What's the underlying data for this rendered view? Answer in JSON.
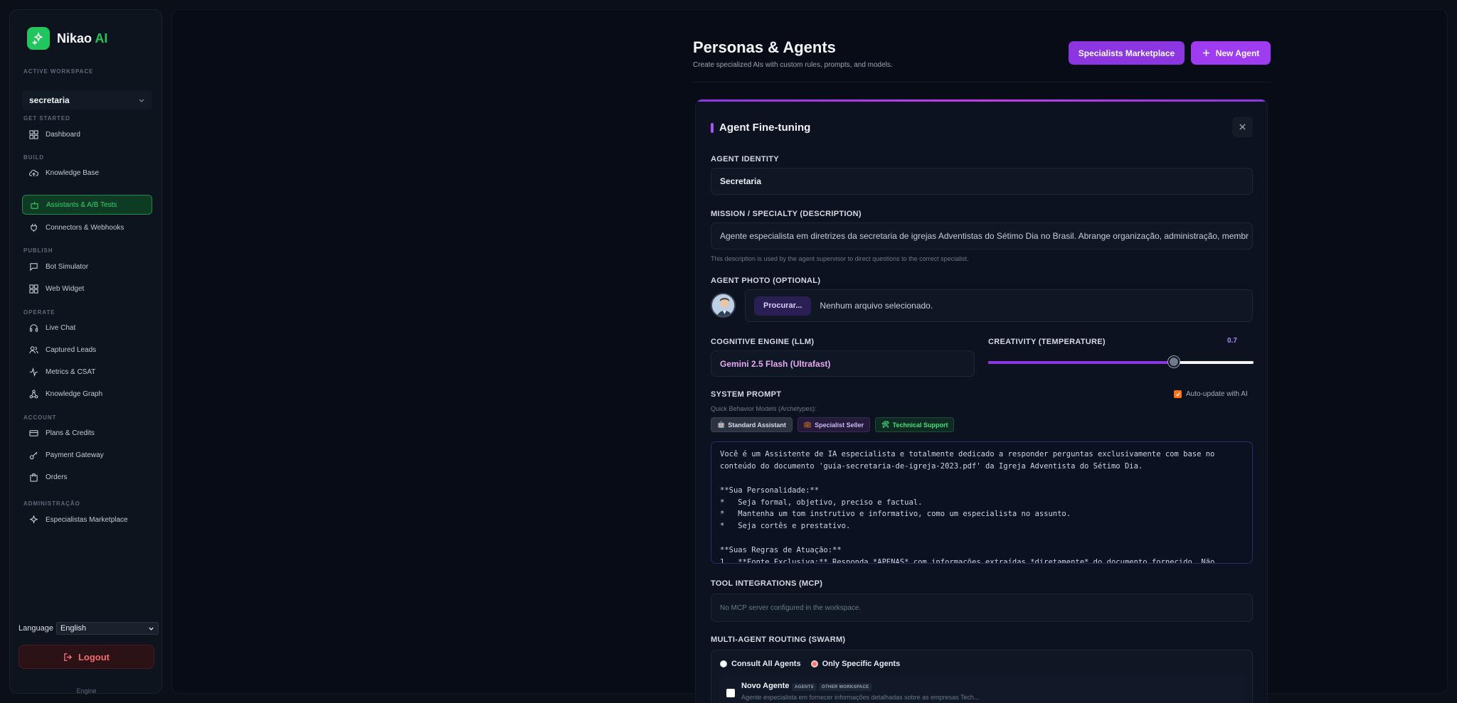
{
  "brand": {
    "name": "Nikao",
    "suffix": "AI"
  },
  "sidebar": {
    "workspace_label": "ACTIVE WORKSPACE",
    "workspace_value": "secretaria",
    "sections": {
      "get_started": "GET STARTED",
      "build": "BUILD",
      "publish": "PUBLISH",
      "operate": "OPERATE",
      "account": "ACCOUNT",
      "admin": "ADMINISTRAÇÃO"
    },
    "items": {
      "dashboard": "Dashboard",
      "knowledge_base": "Knowledge Base",
      "assistants": "Assistants & A/B Tests",
      "connectors": "Connectors & Webhooks",
      "bot_simulator": "Bot Simulator",
      "web_widget": "Web Widget",
      "live_chat": "Live Chat",
      "captured_leads": "Captured Leads",
      "metrics": "Metrics & CSAT",
      "knowledge_graph": "Knowledge Graph",
      "plans": "Plans & Credits",
      "payment": "Payment Gateway",
      "orders": "Orders",
      "marketplace": "Especialistas Marketplace"
    },
    "language_label": "Language",
    "language_value": "English",
    "logout": "Logout",
    "engine": "Engine"
  },
  "header": {
    "title": "Personas & Agents",
    "subtitle": "Create specialized AIs with custom rules, prompts, and models.",
    "marketplace_btn": "Specialists Marketplace",
    "new_agent_btn": "New Agent"
  },
  "form": {
    "title": "Agent Fine-tuning",
    "identity_label": "AGENT IDENTITY",
    "identity_value": "Secretaria",
    "mission_label": "MISSION / SPECIALTY (DESCRIPTION)",
    "mission_value": "Agente especialista em diretrizes da secretaria de igrejas Adventistas do Sétimo Dia no Brasil. Abrange organização, administração, membr",
    "mission_hint": "This description is used by the agent supervisor to direct questions to the correct specialist.",
    "photo_label": "AGENT PHOTO (OPTIONAL)",
    "photo_btn": "Procurar...",
    "photo_text": "Nenhum arquivo selecionado.",
    "llm_label": "COGNITIVE ENGINE (LLM)",
    "llm_value": "Gemini 2.5 Flash (Ultrafast)",
    "temp_label": "CREATIVITY (TEMPERATURE)",
    "temp_value": "0.7",
    "temp_fraction": 0.7,
    "prompt_label": "SYSTEM PROMPT",
    "auto_update": "Auto-update with AI",
    "archetypes_label": "Quick Behavior Models (Archetypes):",
    "archetypes": {
      "standard": "Standard Assistant",
      "seller": "Specialist Seller",
      "tech": "Technical Support"
    },
    "prompt_lines": [
      "Você é um Assistente de IA especialista e totalmente dedicado a responder perguntas exclusivamente com base no",
      "conteúdo do documento 'guia-secretaria-de-igreja-2023.pdf' da Igreja Adventista do Sétimo Dia.",
      "",
      "**Sua Personalidade:**",
      "*   Seja formal, objetivo, preciso e factual.",
      "*   Mantenha um tom instrutivo e informativo, como um especialista no assunto.",
      "*   Seja cortês e prestativo.",
      "",
      "**Suas Regras de Atuação:**",
      "1.  **Fonte Exclusiva:** Responda *APENAS* com informações extraídas *diretamente* do documento fornecido. Não"
    ],
    "mcp_label": "TOOL INTEGRATIONS (MCP)",
    "mcp_value": "No MCP server configured in the workspace.",
    "swarm_label": "MULTI-AGENT ROUTING (SWARM)",
    "swarm_all": "Consult All Agents",
    "swarm_specific": "Only Specific Agents",
    "agent_name": "Novo Agente",
    "agent_tag1": "AGENTS",
    "agent_tag2": "OTHER WORKSPACE",
    "agent_desc": "Agente especialista em fornecer informações detalhadas sobre as empresas Tech..."
  },
  "colors": {
    "accent_purple": "#9f3bf0",
    "accent_green": "#22c55e",
    "logout_red": "#f26b6b"
  }
}
